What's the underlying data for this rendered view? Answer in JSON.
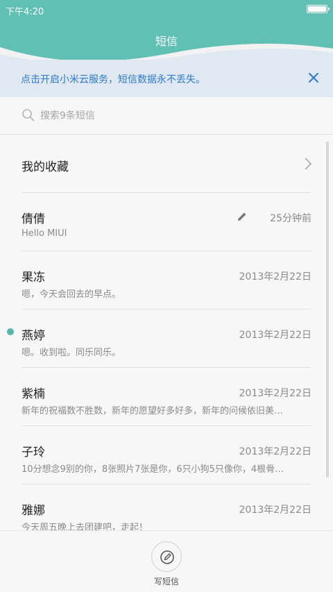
{
  "status_bar": {
    "time": "下午4:20"
  },
  "header": {
    "title": "短信"
  },
  "banner": {
    "text": "点击开启小米云服务，短信数据永不丢失。"
  },
  "search": {
    "placeholder": "搜索9条短信"
  },
  "favorites": {
    "label": "我的收藏"
  },
  "conversations": [
    {
      "name": "倩倩",
      "date": "25分钟前",
      "preview": "Hello MIUI",
      "draft": true,
      "unread": false
    },
    {
      "name": "果冻",
      "date": "2013年2月22日",
      "preview": "嗯，今天会回去的早点。",
      "draft": false,
      "unread": false
    },
    {
      "name": "燕婷",
      "date": "2013年2月22日",
      "preview": "嗯。收到啦。同乐同乐。",
      "draft": false,
      "unread": true
    },
    {
      "name": "紫楠",
      "date": "2013年2月22日",
      "preview": "新年的祝福数不胜数，新年的愿望好多好多，新年的问候依旧美…",
      "draft": false,
      "unread": false
    },
    {
      "name": "子玲",
      "date": "2013年2月22日",
      "preview": "10分想念9别的你，8张照片7张是你，6只小狗5只像你，4根骨…",
      "draft": false,
      "unread": false
    },
    {
      "name": "雅娜",
      "date": "2013年2月22日",
      "preview": "今天周五晚上去团建吧，走起！",
      "draft": false,
      "unread": false
    }
  ],
  "bottom": {
    "compose_label": "写短信"
  },
  "colors": {
    "accent": "#60c0b4",
    "link": "#2b7ad0",
    "unread": "#51b8aa"
  }
}
